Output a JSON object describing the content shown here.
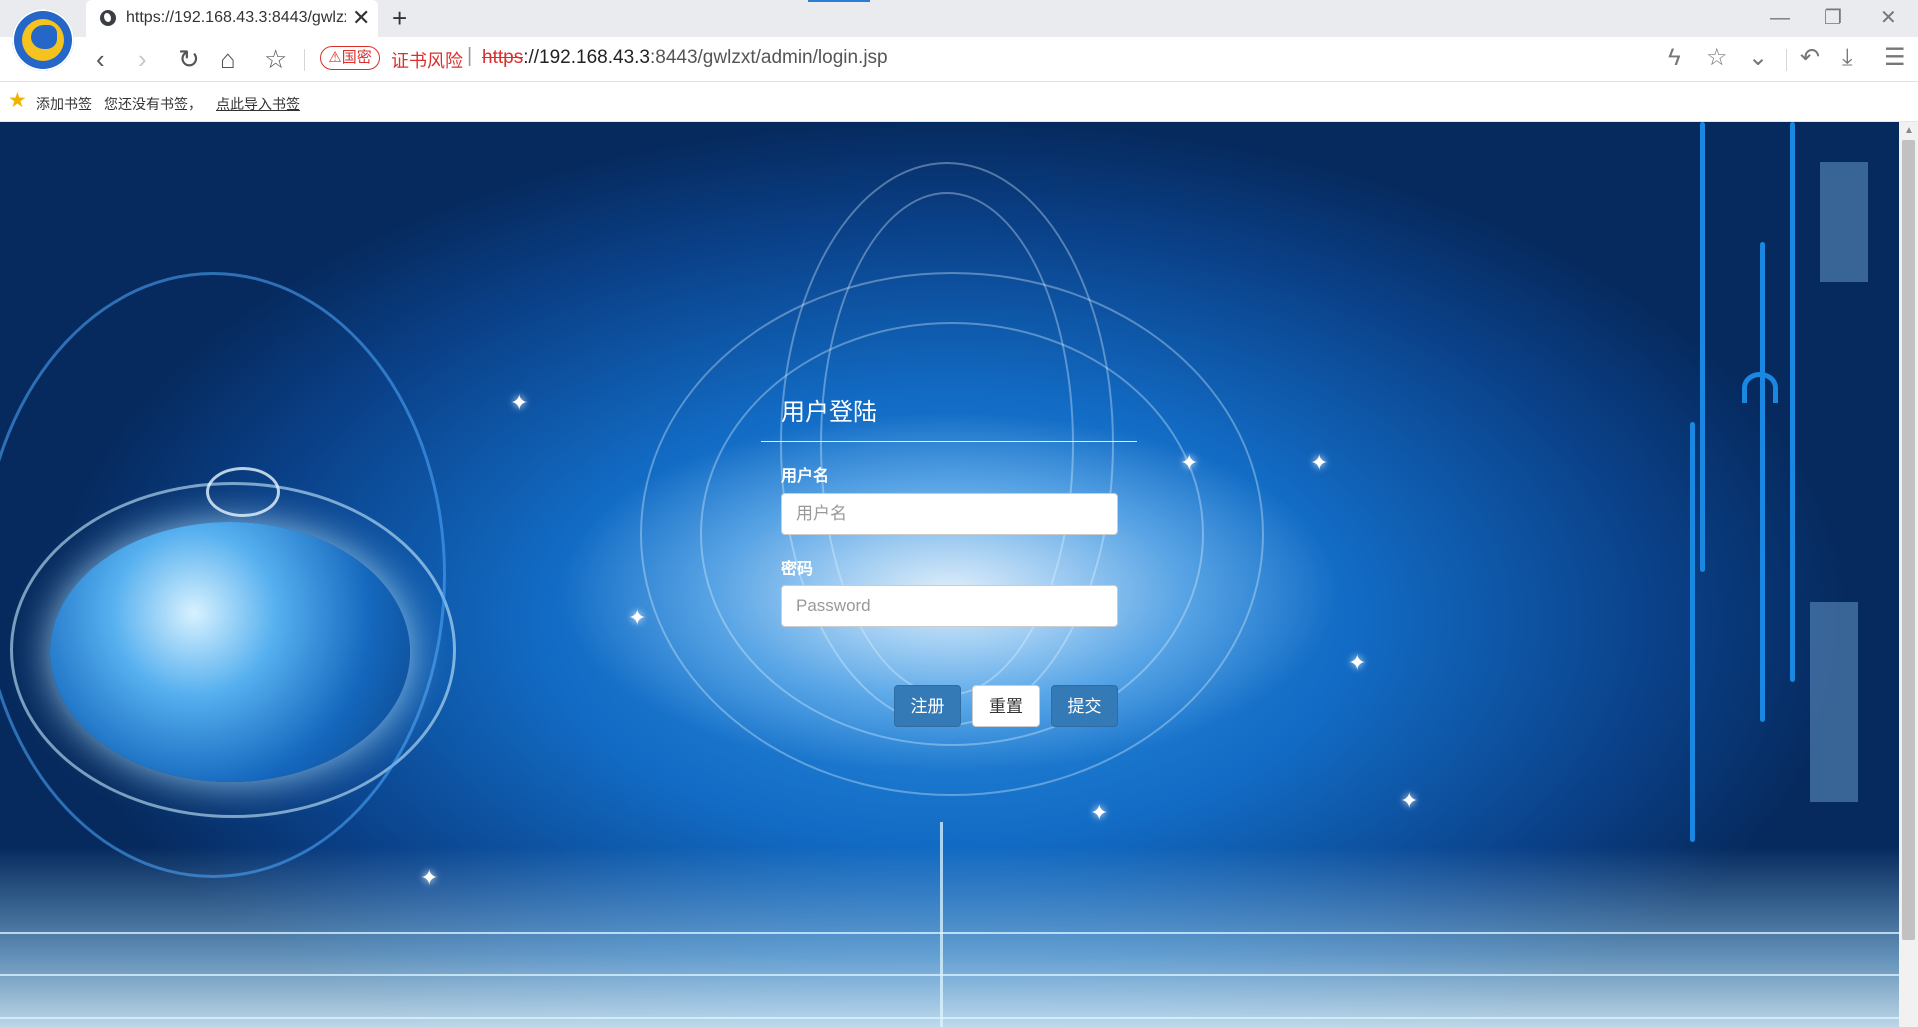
{
  "browser": {
    "tab": {
      "title": "https://192.168.43.3:8443/gwlzxt/admin/login.jsp",
      "close_glyph": "✕",
      "new_tab_glyph": "+",
      "icon": "globe-icon"
    },
    "window_controls": {
      "minimize": "—",
      "restore": "❐",
      "close": "✕"
    },
    "nav": {
      "back": "‹",
      "forward": "›",
      "reload": "↻",
      "home": "⌂",
      "favorite": "☆"
    },
    "security": {
      "badge": "⚠国密",
      "warning": "证书风险",
      "separator": "|"
    },
    "url": {
      "protocol": "https",
      "host": "://192.168.43.3",
      "rest": ":8443/gwlzxt/admin/login.jsp"
    },
    "right_tools": {
      "flash": "ϟ",
      "star": "☆",
      "dropdown": "⌄",
      "undo": "↶",
      "download": "⤓",
      "menu": "☰"
    }
  },
  "bookmarks": {
    "star_glyph": "★",
    "add": "添加书签",
    "empty_message": "您还没有书签，",
    "import_link": "点此导入书签"
  },
  "login": {
    "title": "用户登陆",
    "username_label": "用户名",
    "username_placeholder": "用户名",
    "password_label": "密码",
    "password_placeholder": "Password",
    "buttons": {
      "register": "注册",
      "reset": "重置",
      "submit": "提交"
    }
  },
  "theme": {
    "primary_button": "#337ab7",
    "risk_red": "#d9302d",
    "background_blue": "#126bc4"
  }
}
